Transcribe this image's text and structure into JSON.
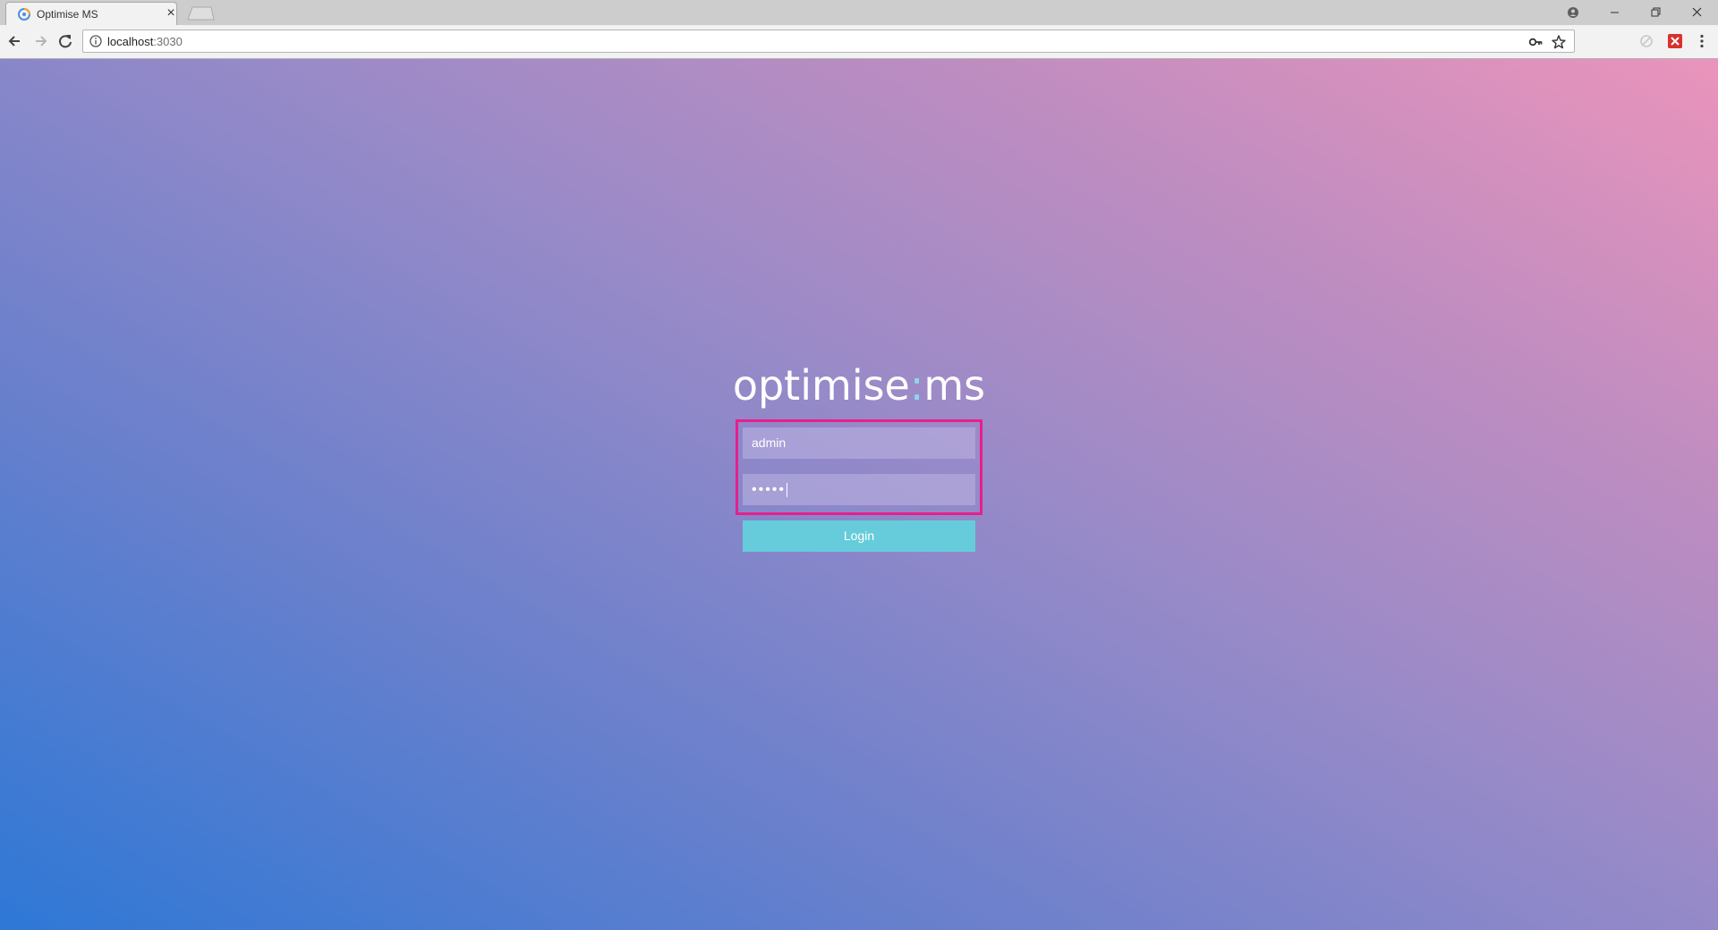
{
  "browser": {
    "tab_title": "Optimise MS",
    "tab_close": "×",
    "url_host": "localhost",
    "url_port": ":3030"
  },
  "page": {
    "logo_left": "optimise",
    "logo_sep": ":",
    "logo_right": "ms",
    "username_value": "admin",
    "password_masked": "•••••",
    "login_label": "Login"
  },
  "colors": {
    "highlight_border": "#e81e8c",
    "login_button": "#66ccdb",
    "logo_separator": "#8fd8ea"
  }
}
